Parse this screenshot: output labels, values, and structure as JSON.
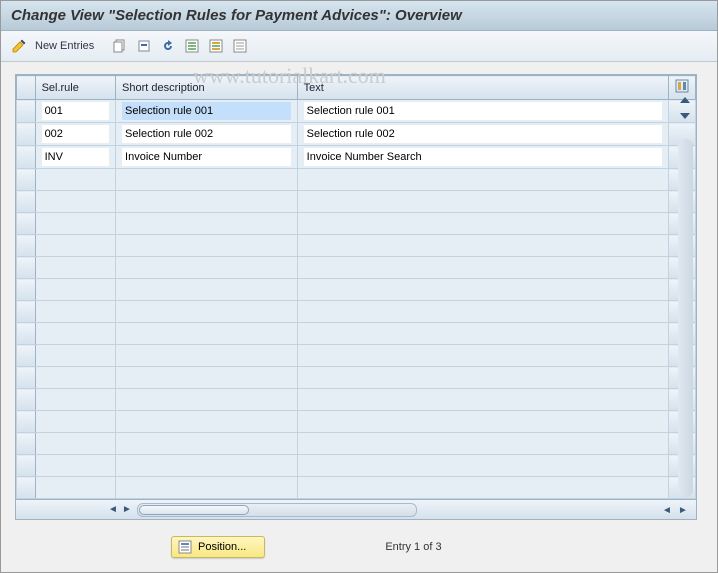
{
  "title": "Change View \"Selection Rules for Payment Advices\": Overview",
  "toolbar": {
    "new_entries_label": "New Entries"
  },
  "watermark": "www.tutorialkart.com",
  "table": {
    "headers": {
      "rule": "Sel.rule",
      "desc": "Short description",
      "text": "Text"
    },
    "rows": [
      {
        "rule": "001",
        "desc": "Selection rule 001",
        "text": "Selection rule 001",
        "selected": true
      },
      {
        "rule": "002",
        "desc": "Selection rule 002",
        "text": "Selection rule 002",
        "selected": false
      },
      {
        "rule": "INV",
        "desc": "Invoice Number",
        "text": "Invoice Number Search",
        "selected": false
      }
    ],
    "empty_rows": 15
  },
  "footer": {
    "position_label": "Position...",
    "entry_text": "Entry 1 of 3"
  }
}
